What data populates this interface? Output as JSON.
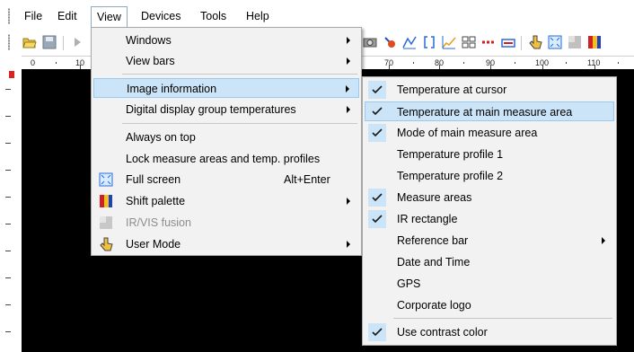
{
  "menubar": {
    "items": [
      "File",
      "Edit",
      "View",
      "Devices",
      "Tools",
      "Help"
    ]
  },
  "ruler": {
    "labels": [
      "0",
      "10",
      "70",
      "80",
      "90",
      "100",
      "110"
    ]
  },
  "view_menu": {
    "items": [
      {
        "label": "Windows",
        "submenu": true
      },
      {
        "label": "View bars",
        "submenu": true
      },
      {
        "label": "Image information",
        "submenu": true,
        "highlighted": true
      },
      {
        "label": "Digital display group temperatures",
        "submenu": true
      },
      {
        "label": "Always on top"
      },
      {
        "label": "Lock measure areas and temp. profiles"
      },
      {
        "label": "Full screen",
        "shortcut": "Alt+Enter",
        "icon": "fullscreen-icon"
      },
      {
        "label": "Shift palette",
        "submenu": true,
        "icon": "palette-icon"
      },
      {
        "label": "IR/VIS fusion",
        "disabled": true,
        "icon": "fusion-icon"
      },
      {
        "label": "User Mode",
        "submenu": true,
        "icon": "hand-pointer-icon"
      }
    ]
  },
  "image_info_menu": {
    "items": [
      {
        "label": "Temperature at cursor",
        "checked": true
      },
      {
        "label": "Temperature at main measure area",
        "checked": true,
        "highlighted": true
      },
      {
        "label": "Mode of main measure area",
        "checked": true
      },
      {
        "label": "Temperature profile 1",
        "checked": false
      },
      {
        "label": "Temperature profile 2",
        "checked": false
      },
      {
        "label": "Measure areas",
        "checked": true
      },
      {
        "label": "IR rectangle",
        "checked": true
      },
      {
        "label": "Reference bar",
        "checked": false,
        "submenu": true
      },
      {
        "label": "Date and Time",
        "checked": false
      },
      {
        "label": "GPS",
        "checked": false
      },
      {
        "label": "Corporate logo",
        "checked": false
      },
      {
        "label": "Use contrast color",
        "checked": true
      }
    ]
  },
  "colors": {
    "highlight_bg": "#cce4f7",
    "highlight_border": "#99c9ef",
    "check_bg": "#cce4f7",
    "image_bg": "#000000"
  }
}
